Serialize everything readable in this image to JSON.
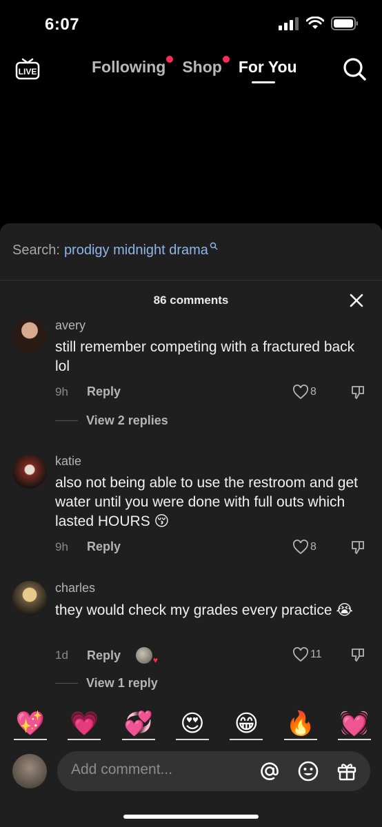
{
  "status_bar": {
    "time": "6:07"
  },
  "top_nav": {
    "live_label": "LIVE",
    "tabs": [
      {
        "label": "Following",
        "has_dot": true
      },
      {
        "label": "Shop",
        "has_dot": true
      },
      {
        "label": "For You",
        "has_dot": false
      }
    ]
  },
  "comments_sheet": {
    "search_label": "Search:",
    "search_query": "prodigy midnight drama",
    "count_label": "86 comments",
    "comments": [
      {
        "user": "avery",
        "text": "still remember competing with a fractured back lol",
        "time": "9h",
        "reply_label": "Reply",
        "likes": "8",
        "view_replies": "View 2 replies"
      },
      {
        "user": "katie",
        "text": "also not being able to use the restroom and get water until you were done with full outs which lasted HOURS 😚",
        "time": "9h",
        "reply_label": "Reply",
        "likes": "8"
      },
      {
        "user": "charles",
        "text": "they would check my grades every practice 😭",
        "time": "1d",
        "reply_label": "Reply",
        "likes": "11",
        "view_replies": "View 1 reply"
      }
    ]
  },
  "quick_emojis": [
    "💖",
    "💗",
    "💞",
    "😍",
    "😁",
    "🔥",
    "💓"
  ],
  "comment_input": {
    "placeholder": "Add comment..."
  },
  "colors": {
    "accent": "#fe2c55",
    "link": "#8fb6e8",
    "sheet_bg": "#1f1f1f"
  },
  "icons": [
    "live-icon",
    "search-icon",
    "close-icon",
    "heart-icon",
    "dislike-icon",
    "at-icon",
    "emoji-icon",
    "gift-icon"
  ]
}
